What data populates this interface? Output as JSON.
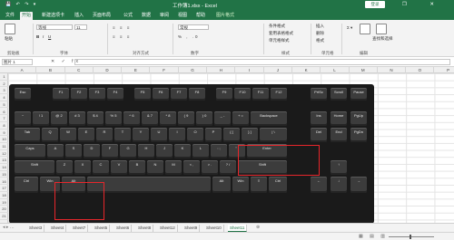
{
  "titlebar": {
    "doc_title": "工作簿1.xlsx  -  Excel",
    "login": "登录",
    "window_controls": "—  ❐  ✕",
    "qat": "💾 ↶ ↷ ▾"
  },
  "tabs": [
    {
      "label": "文件"
    },
    {
      "label": "开始"
    },
    {
      "label": "新建选项卡"
    },
    {
      "label": "插入"
    },
    {
      "label": "页面布局"
    },
    {
      "label": "公式"
    },
    {
      "label": "数据"
    },
    {
      "label": "审阅"
    },
    {
      "label": "视图"
    },
    {
      "label": "帮助"
    },
    {
      "label": "图片格式"
    }
  ],
  "ribbon": {
    "paste": "粘贴",
    "clipboard": "剪贴板",
    "font": "字体",
    "alignment": "对齐方式",
    "number": "数字",
    "style": "样式",
    "cells": "单元格",
    "editing": "编辑",
    "find": "查找和选择",
    "font_name": "等线",
    "font_size": "11",
    "number_format": "常规",
    "conditional": "条件格式",
    "table": "套用表格格式",
    "cell_style": "单元格样式",
    "insert": "插入",
    "delete": "删除",
    "format": "格式"
  },
  "formula_bar": {
    "name_box": "图片 1",
    "fx": "✕ ✓ fx",
    "value": ""
  },
  "columns": [
    "A",
    "B",
    "C",
    "D",
    "E",
    "F",
    "G",
    "H",
    "I",
    "J",
    "K",
    "L",
    "M",
    "N",
    "O",
    "P"
  ],
  "rows": [
    "1",
    "2",
    "3",
    "4",
    "5",
    "6",
    "7",
    "8",
    "9",
    "10",
    "11",
    "12",
    "13",
    "14",
    "15",
    "16",
    "17",
    "18",
    "19",
    "20",
    "21"
  ],
  "keys": {
    "esc": "Esc",
    "f1": "F1",
    "f2": "F2",
    "f3": "F3",
    "f4": "F4",
    "f5": "F5",
    "f6": "F6",
    "f7": "F7",
    "f8": "F8",
    "f9": "F9",
    "f10": "F10",
    "f11": "F11",
    "f12": "F12",
    "prtsc": "PrtSc",
    "scroll": "Scroll",
    "pause": "Pause",
    "tilde": "~",
    "n1": "! 1",
    "n2": "@ 2",
    "n3": "# 3",
    "n4": "$ 4",
    "n5": "% 5",
    "n6": "^ 6",
    "n7": "& 7",
    "n8": "* 8",
    "n9": "( 9",
    "n0": ") 0",
    "minus": "_ -",
    "plus": "+ =",
    "backspace": "Backspace",
    "insert": "Ins",
    "home": "Home",
    "pgup": "PgUp",
    "tab": "Tab",
    "q": "Q",
    "w": "W",
    "e": "E",
    "r": "R",
    "t": "T",
    "y": "Y",
    "u": "U",
    "i": "I",
    "o": "O",
    "p": "P",
    "lbr": "{ [",
    "rbr": "} ]",
    "bslash": "| \\",
    "del": "Del",
    "end": "End",
    "pgdn": "PgDn",
    "caps": "Caps",
    "a": "A",
    "s": "S",
    "d": "D",
    "f": "F",
    "g": "G",
    "h": "H",
    "j": "J",
    "k": "K",
    "l": "L",
    "semi": ": ;",
    "quote": "\" '",
    "enter": "Enter",
    "shift": "Shift",
    "z": "Z",
    "x": "X",
    "c": "C",
    "v": "V",
    "b": "B",
    "n": "N",
    "m": "M",
    "comma": "< ,",
    "dot": "> .",
    "slash": "? /",
    "rshift": "Shift",
    "up": "↑",
    "ctrl": "Ctrl",
    "win": "Win",
    "alt": "Alt",
    "ralt": "Alt",
    "rwin": "Win",
    "menu": "≡",
    "rctrl": "Ctrl",
    "left": "←",
    "down": "↓",
    "right": "→"
  },
  "sheets": [
    {
      "name": "Sheet3"
    },
    {
      "name": "Sheet4"
    },
    {
      "name": "Sheet7"
    },
    {
      "name": "Sheet5"
    },
    {
      "name": "Sheet6"
    },
    {
      "name": "Sheet8"
    },
    {
      "name": "Sheet12"
    },
    {
      "name": "Sheet9"
    },
    {
      "name": "Sheet10"
    },
    {
      "name": "Sheet11"
    }
  ],
  "active_sheet": "Sheet11",
  "colors": {
    "excel_green": "#217346",
    "highlight_red": "#e8262b"
  }
}
